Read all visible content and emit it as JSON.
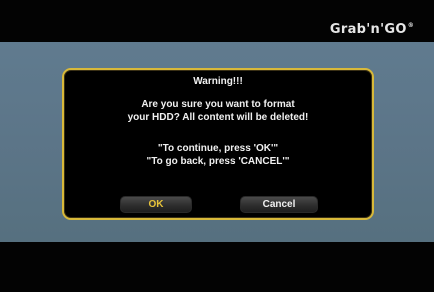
{
  "brand": {
    "logo_text": "Grab'n'GO",
    "logo_mark": "®"
  },
  "dialog": {
    "title": "Warning!!!",
    "message_lines": [
      "Are you sure you want to format",
      "your HDD? All content will be deleted!"
    ],
    "instruction_lines": [
      "\"To continue, press 'OK'\"",
      "\"To go back, press 'CANCEL'\""
    ],
    "buttons": {
      "ok_label": "OK",
      "cancel_label": "Cancel"
    },
    "focused_button": "ok"
  },
  "colors": {
    "dialog_border": "#d8b93a",
    "focused_label": "#e8c43a",
    "background_panel": "#5c7588"
  }
}
